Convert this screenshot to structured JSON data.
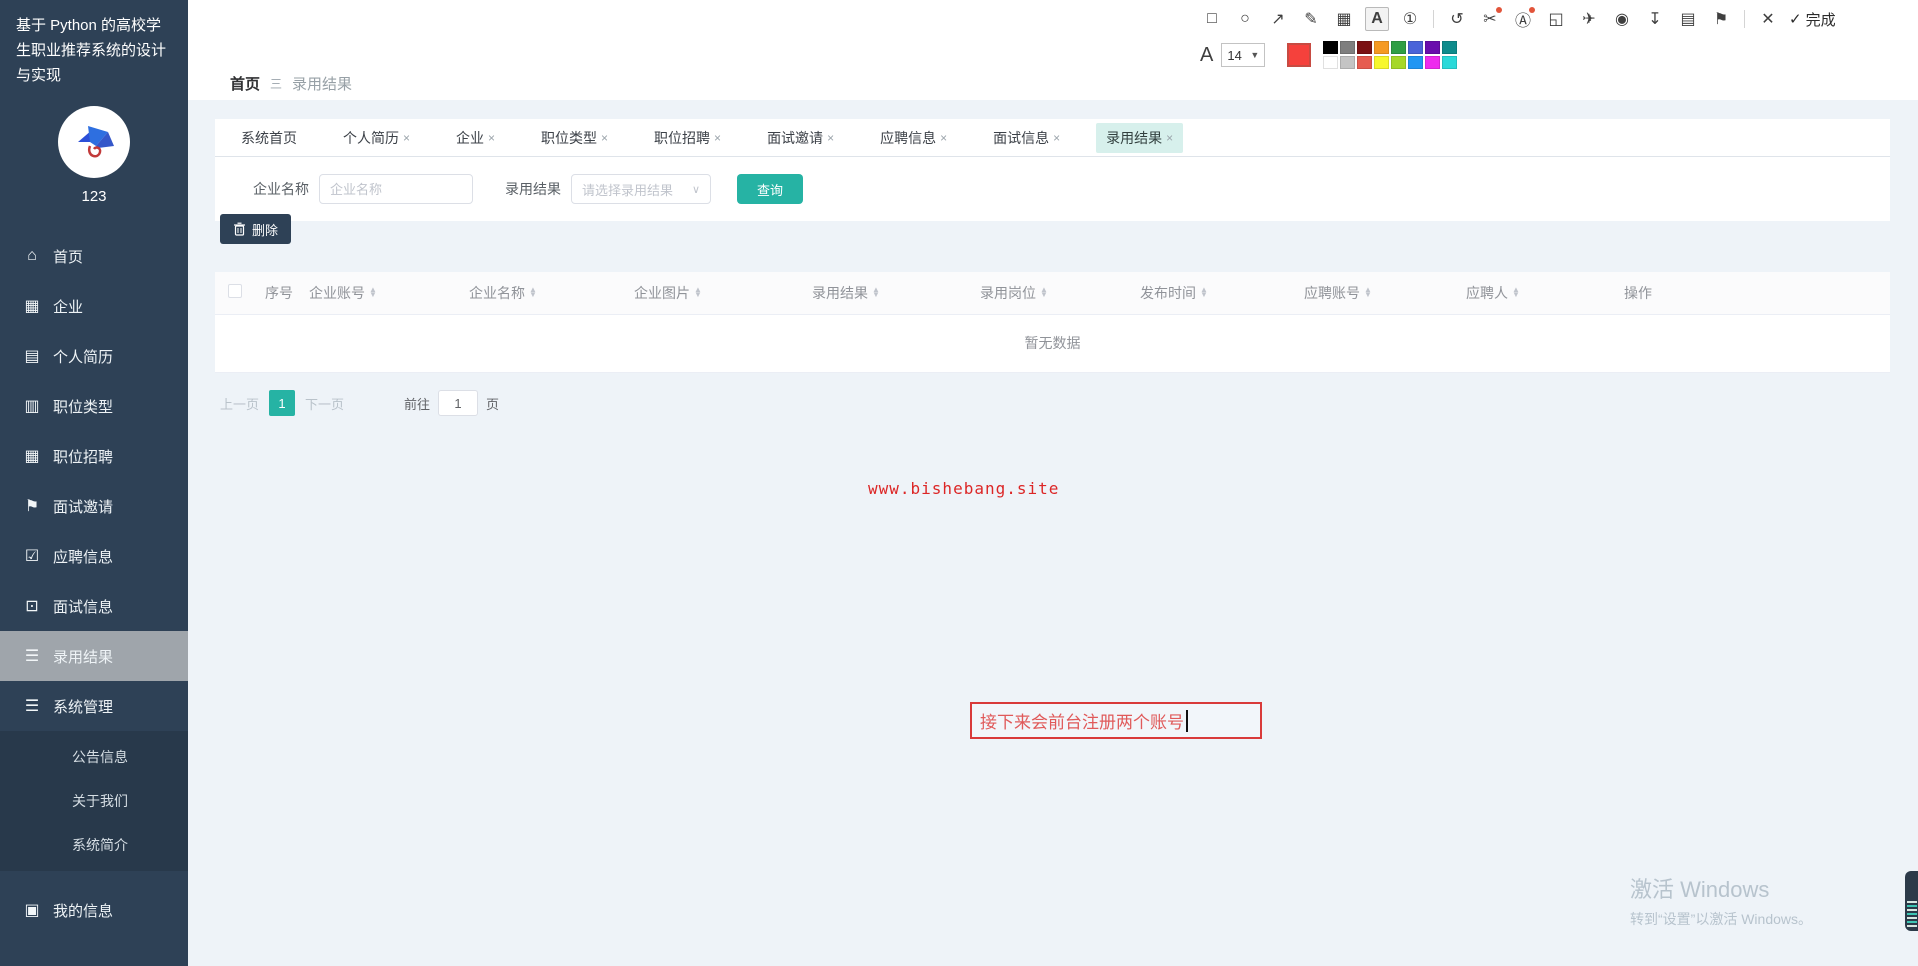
{
  "ui": {
    "close_glyph": "×",
    "caret_up": "▲",
    "caret_down": "▼",
    "select_caret": "∨",
    "dropdown_caret": "▼",
    "breadcrumb_separator": "三"
  },
  "sidebar": {
    "title": "基于 Python 的高校学生职业推荐系统的设计与实现",
    "username": "123",
    "menu": [
      {
        "label": "首页",
        "icon": "home-icon",
        "glyph": "⌂"
      },
      {
        "label": "企业",
        "icon": "grid-icon",
        "glyph": "▦"
      },
      {
        "label": "个人简历",
        "icon": "briefcase-icon",
        "glyph": "▤"
      },
      {
        "label": "职位类型",
        "icon": "clipboard-icon",
        "glyph": "▥"
      },
      {
        "label": "职位招聘",
        "icon": "grid-icon",
        "glyph": "▦"
      },
      {
        "label": "面试邀请",
        "icon": "flag-icon",
        "glyph": "⚑"
      },
      {
        "label": "应聘信息",
        "icon": "checklist-icon",
        "glyph": "☑"
      },
      {
        "label": "面试信息",
        "icon": "monitor-icon",
        "glyph": "⊡"
      },
      {
        "label": "录用结果",
        "icon": "list-icon",
        "glyph": "☰"
      },
      {
        "label": "系统管理",
        "icon": "list-icon",
        "glyph": "☰"
      }
    ],
    "submenu": [
      {
        "label": "公告信息"
      },
      {
        "label": "关于我们"
      },
      {
        "label": "系统简介"
      }
    ],
    "bottom_item": {
      "label": "我的信息",
      "glyph": "▣"
    }
  },
  "breadcrumb": {
    "root": "首页",
    "current": "录用结果"
  },
  "tabs": [
    {
      "label": "系统首页"
    },
    {
      "label": "个人简历"
    },
    {
      "label": "企业"
    },
    {
      "label": "职位类型"
    },
    {
      "label": "职位招聘"
    },
    {
      "label": "面试邀请"
    },
    {
      "label": "应聘信息"
    },
    {
      "label": "面试信息"
    },
    {
      "label": "录用结果"
    }
  ],
  "filters": {
    "company_label": "企业名称",
    "company_placeholder": "企业名称",
    "result_label": "录用结果",
    "result_placeholder": "请选择录用结果",
    "search_button": "查询"
  },
  "actions": {
    "delete_button": "删除"
  },
  "table": {
    "columns": [
      "序号",
      "企业账号",
      "企业名称",
      "企业图片",
      "录用结果",
      "录用岗位",
      "发布时间",
      "应聘账号",
      "应聘人",
      "操作"
    ],
    "empty_text": "暂无数据"
  },
  "pagination": {
    "prev": "上一页",
    "current_page": "1",
    "next": "下一页",
    "goto_label": "前往",
    "goto_value": "1",
    "unit": "页"
  },
  "site_watermark": "www.bishebang.site",
  "annotation_note": {
    "text": "接下来会前台注册两个账号"
  },
  "windows_watermark": {
    "line1": "激活 Windows",
    "line2": "转到“设置”以激活 Windows。"
  },
  "capture_toolbar": {
    "font_size": "14",
    "done_label": "完成",
    "current_color": "#f5413c",
    "icons": [
      {
        "glyph": "□"
      },
      {
        "glyph": "○"
      },
      {
        "glyph": "↗"
      },
      {
        "glyph": "✎"
      },
      {
        "glyph": "▦"
      },
      {
        "glyph": "A"
      },
      {
        "glyph": "①"
      },
      {
        "glyph": "↺"
      },
      {
        "glyph": "✂"
      },
      {
        "glyph": "Ⓐ"
      },
      {
        "glyph": "◱"
      },
      {
        "glyph": "✈"
      },
      {
        "glyph": "◉"
      },
      {
        "glyph": "↧"
      },
      {
        "glyph": "▤"
      },
      {
        "glyph": "⚑"
      },
      {
        "glyph": "✕"
      },
      {
        "glyph": "✓"
      }
    ],
    "palette": [
      "#000000",
      "#7f7f7f",
      "#7b1113",
      "#f59a23",
      "#2f9e44",
      "#4a63d9",
      "#6a0dad",
      "#0e8c8c",
      "#ffffff",
      "#c4c4c4",
      "#e65c50",
      "#f7f72e",
      "#a6d828",
      "#2196f3",
      "#ee2bee",
      "#2bd9d9"
    ]
  },
  "colors": {
    "accent": "#26b3a4",
    "sidebar": "#2e4156",
    "active_tab_bg": "#d7f0ec",
    "danger": "#d93a3a"
  }
}
